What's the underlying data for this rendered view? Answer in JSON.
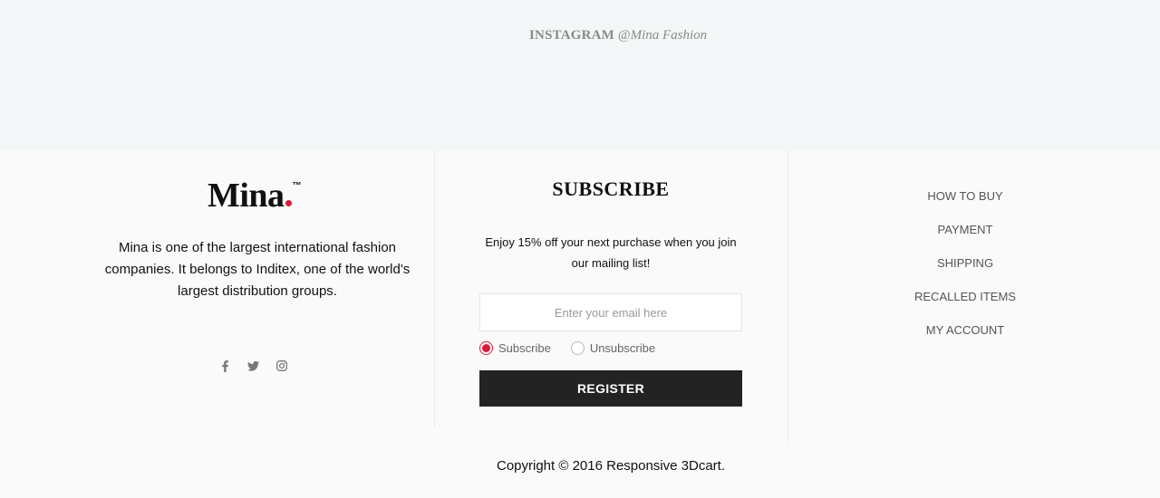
{
  "instagram": {
    "label": "INSTAGRAM",
    "handle": "@Mina Fashion"
  },
  "brand": {
    "name": "Mina",
    "trademark": "™",
    "accent_color": "#d91a3c",
    "about": "Mina is one of the largest international fashion companies. It belongs to Inditex, one of the world's largest distribution groups."
  },
  "social": {
    "icons": [
      "facebook-icon",
      "twitter-icon",
      "instagram-icon"
    ]
  },
  "subscribe": {
    "title": "SUBSCRIBE",
    "description": "Enjoy 15% off your next purchase when you join our mailing list!",
    "email_placeholder": "Enter your email here",
    "email_value": "",
    "options": [
      {
        "label": "Subscribe",
        "selected": true
      },
      {
        "label": "Unsubscribe",
        "selected": false
      }
    ],
    "button_label": "REGISTER",
    "button_color": "#232323"
  },
  "links": [
    {
      "label": "HOW TO BUY"
    },
    {
      "label": "PAYMENT"
    },
    {
      "label": "SHIPPING"
    },
    {
      "label": "RECALLED ITEMS"
    },
    {
      "label": "MY ACCOUNT"
    }
  ],
  "copyright": "Copyright © 2016 Responsive 3Dcart."
}
